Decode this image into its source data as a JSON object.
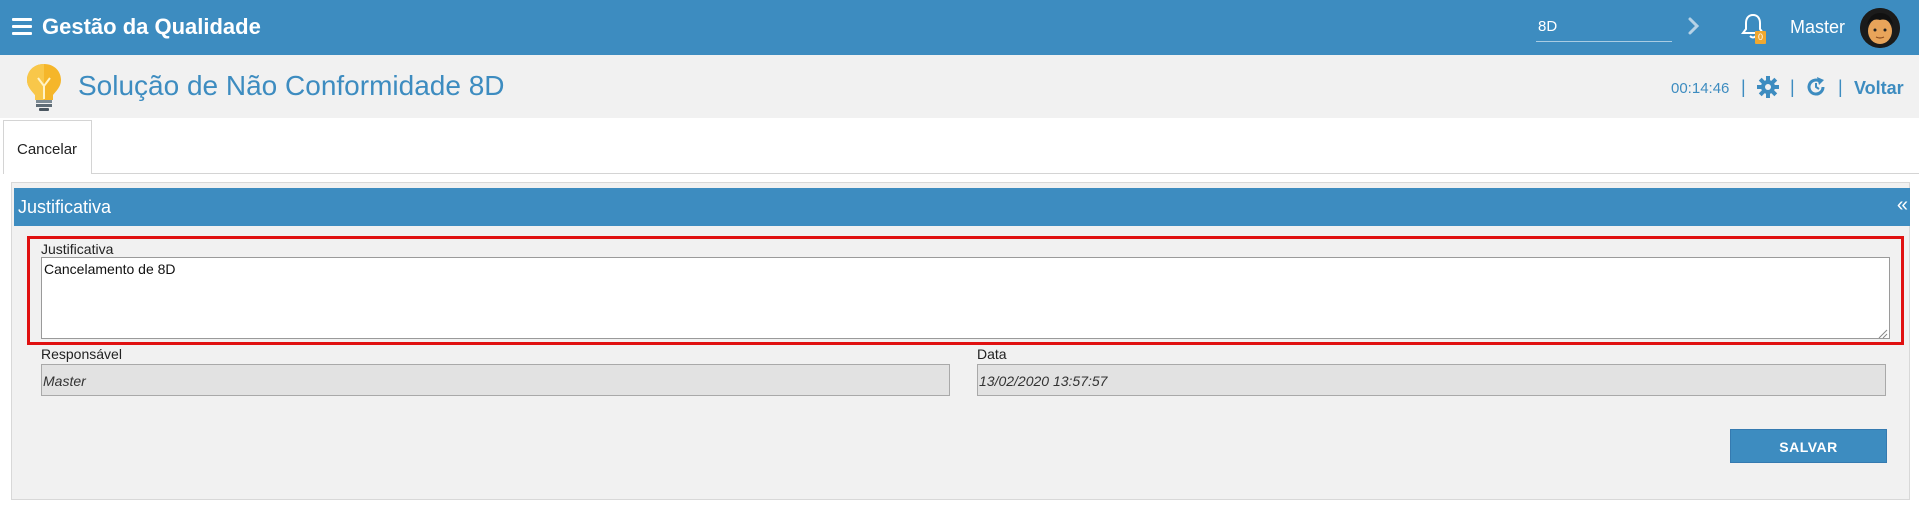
{
  "header": {
    "app_title": "Gestão da Qualidade",
    "search_value": "8D",
    "notification_count": "0",
    "user_name": "Master"
  },
  "titlebar": {
    "page_title": "Solução de Não Conformidade 8D",
    "timer": "00:14:46",
    "separator": "|",
    "back_label": "Voltar"
  },
  "tabs": [
    {
      "label": "Cancelar",
      "active": true
    }
  ],
  "panel": {
    "title": "Justificativa",
    "collapse_glyph": "«",
    "justificativa_label": "Justificativa",
    "justificativa_value": "Cancelamento de 8D",
    "responsavel_label": "Responsável",
    "responsavel_value": "Master",
    "data_label": "Data",
    "data_value": "13/02/2020 13:57:57",
    "save_label": "SALVAR"
  },
  "icons": {
    "menu": "menu-icon",
    "search_go": "chevron-right-icon",
    "notifications": "bell-icon",
    "avatar": "avatar",
    "page": "lightbulb-icon",
    "settings": "gear-icon",
    "refresh": "refresh-icon"
  },
  "colors": {
    "primary": "#3d8cc0",
    "highlight": "#e01010",
    "badge": "#f0a830"
  }
}
